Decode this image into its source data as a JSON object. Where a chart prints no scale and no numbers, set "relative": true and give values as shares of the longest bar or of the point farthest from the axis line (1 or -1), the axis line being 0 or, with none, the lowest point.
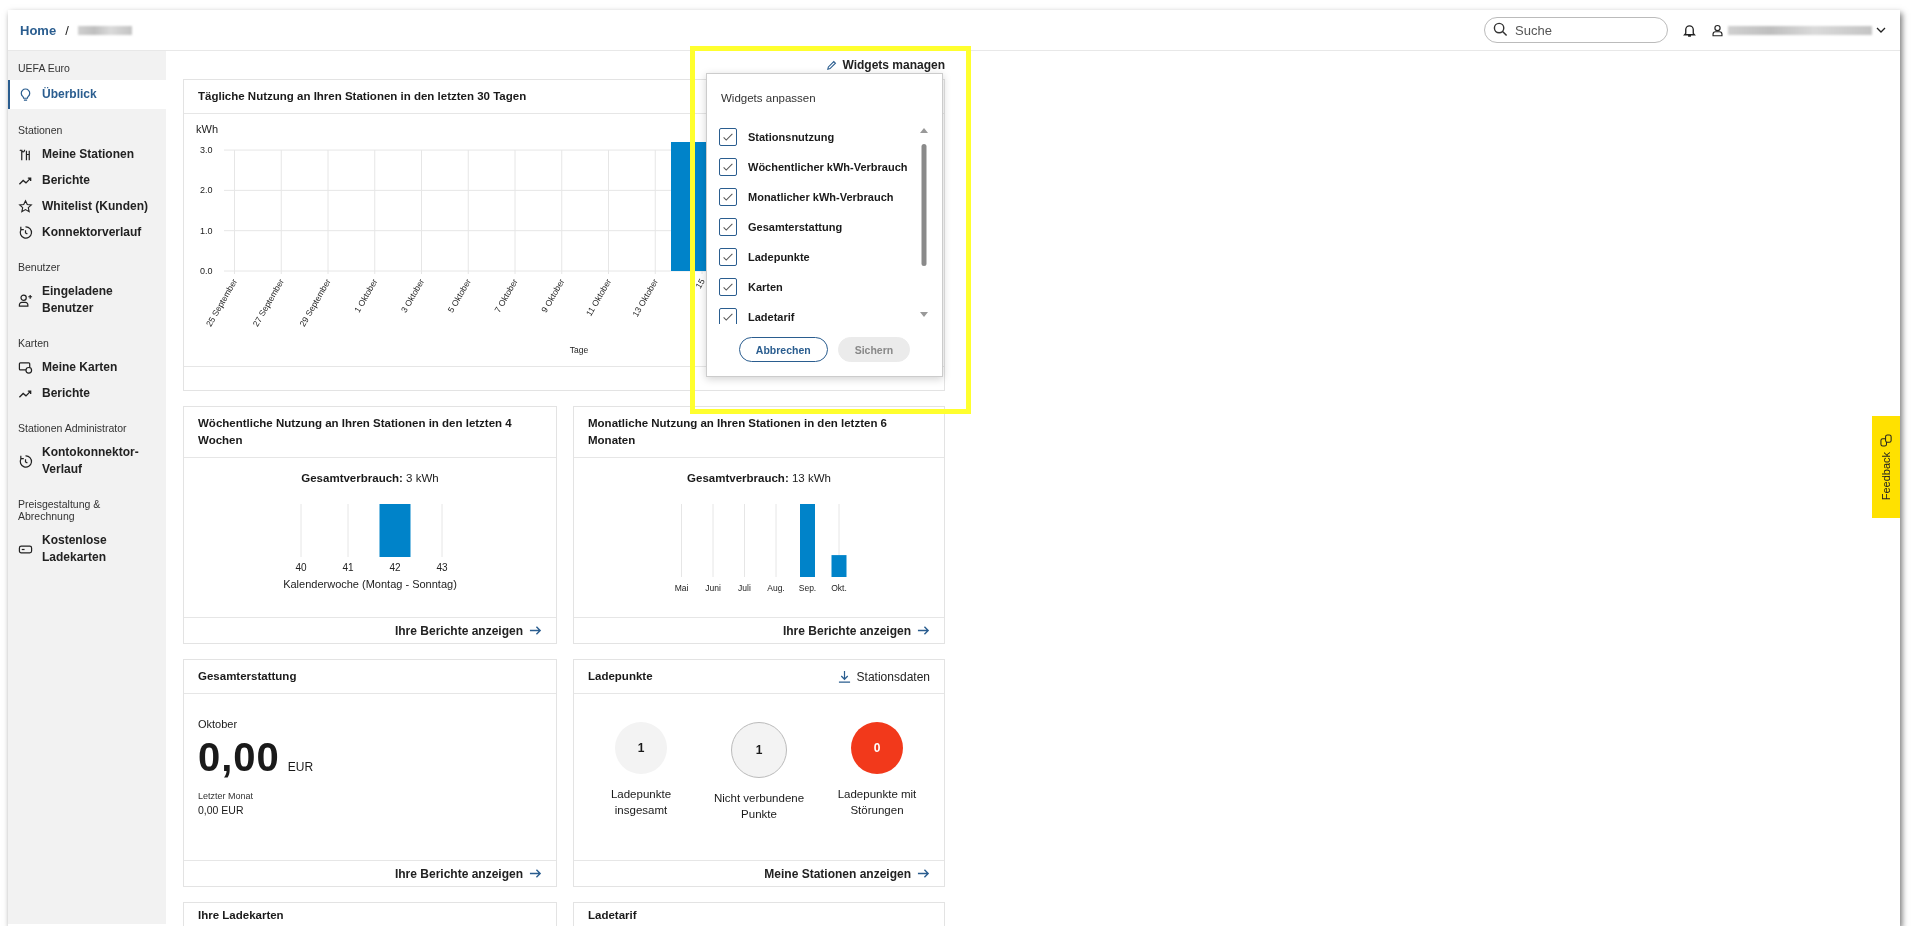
{
  "breadcrumb": {
    "home": "Home",
    "separator": "/"
  },
  "search": {
    "placeholder": "Suche"
  },
  "sidebar": {
    "sections": [
      {
        "title": "UEFA Euro",
        "items": [
          {
            "label": "Überblick",
            "selected": true
          }
        ]
      },
      {
        "title": "Stationen",
        "items": [
          {
            "label": "Meine Stationen",
            "selected": false
          },
          {
            "label": "Berichte",
            "selected": false
          },
          {
            "label": "Whitelist (Kunden)",
            "selected": false
          },
          {
            "label": "Konnektorverlauf",
            "selected": false
          }
        ]
      },
      {
        "title": "Benutzer",
        "items": [
          {
            "label": "Eingeladene Benutzer",
            "selected": false
          }
        ]
      },
      {
        "title": "Karten",
        "items": [
          {
            "label": "Meine Karten",
            "selected": false
          },
          {
            "label": "Berichte",
            "selected": false
          }
        ]
      },
      {
        "title": "Stationen Administrator",
        "items": [
          {
            "label": "Kontokonnektor-Verlauf",
            "selected": false
          }
        ]
      },
      {
        "title": "Preisgestaltung & Abrechnung",
        "items": [
          {
            "label": "Kostenlose Ladekarten",
            "selected": false
          }
        ]
      }
    ]
  },
  "widgets_button": "Widgets managen",
  "daily_card": {
    "title": "Tägliche Nutzung an Ihren Stationen in den letzten 30 Tagen",
    "chart_data": {
      "type": "bar",
      "ylabel": "kWh",
      "xlabel": "Tage",
      "grid": true,
      "categories": [
        "25 September",
        "27 September",
        "29 September",
        "1 Oktober",
        "3 Oktober",
        "5 Oktober",
        "7 Oktober",
        "9 Oktober",
        "11 Oktober",
        "13 Oktober",
        "15"
      ],
      "series": [
        {
          "color": "#0083c9",
          "values": [
            0,
            0,
            0,
            0,
            0,
            0,
            0,
            0,
            0,
            0,
            3.2
          ]
        }
      ],
      "ylim": [
        0,
        3.2
      ],
      "yticks": [
        {
          "value": 0,
          "label": "0.0"
        },
        {
          "value": 1,
          "label": "1.0"
        },
        {
          "value": 2,
          "label": "2.0"
        },
        {
          "value": 3,
          "label": "3.0"
        }
      ]
    }
  },
  "weekly_card": {
    "title": "Wöchentliche Nutzung an Ihren Stationen in den letzten 4 Wochen",
    "total": "**Gesamtverbrauch:** 3 kWh",
    "link": "Ihre Berichte anzeigen",
    "chart_data": {
      "type": "bar",
      "relative": true,
      "grid": true,
      "xlabel": "Kalenderwoche (Montag - Sonntag)",
      "categories": [
        "40",
        "41",
        "42",
        "43"
      ],
      "series": [
        {
          "color": "#0083c9",
          "values": [
            0,
            0,
            1,
            0
          ]
        }
      ]
    }
  },
  "monthly_card": {
    "title": "Monatliche Nutzung an Ihren Stationen in den letzten 6 Monaten",
    "total": "**Gesamtverbrauch:** 13 kWh",
    "link": "Ihre Berichte anzeigen",
    "chart_data": {
      "type": "bar",
      "relative": true,
      "grid": true,
      "categories": [
        "Mai",
        "Juni",
        "Juli",
        "Aug.",
        "Sep.",
        "Okt."
      ],
      "series": [
        {
          "color": "#0083c9",
          "values": [
            0,
            0,
            0,
            0,
            1,
            0.3
          ]
        }
      ]
    }
  },
  "refund_card": {
    "title": "Gesamterstattung",
    "month": "Oktober",
    "amount": "0,00",
    "currency": "EUR",
    "last_label": "Letzter Monat",
    "last_value": "0,00 EUR",
    "link": "Ihre Berichte anzeigen"
  },
  "points_card": {
    "title": "Ladepunkte",
    "action": "Stationsdaten",
    "link": "Meine Stationen anzeigen",
    "stats": [
      {
        "value": "1",
        "label": "Ladepunkte insgesamt",
        "kind": "neutral"
      },
      {
        "value": "1",
        "label": "Nicht verbundene Punkte",
        "kind": "outlined"
      },
      {
        "value": "0",
        "label": "Ladepunkte mit Störungen",
        "kind": "alert"
      }
    ]
  },
  "lower_cards": [
    {
      "title": "Ihre Ladekarten"
    },
    {
      "title": "Ladetarif"
    }
  ],
  "widgets_popup": {
    "title": "Widgets anpassen",
    "items": [
      {
        "label": "Stationsnutzung",
        "checked": true
      },
      {
        "label": "Wöchentlicher kWh-Verbrauch",
        "checked": true
      },
      {
        "label": "Monatlicher kWh-Verbrauch",
        "checked": true
      },
      {
        "label": "Gesamterstattung",
        "checked": true
      },
      {
        "label": "Ladepunkte",
        "checked": true
      },
      {
        "label": "Karten",
        "checked": true
      },
      {
        "label": "Ladetarif",
        "checked": true
      }
    ],
    "cancel": "Abbrechen",
    "save": "Sichern",
    "save_disabled": true
  },
  "feedback": "Feedback"
}
